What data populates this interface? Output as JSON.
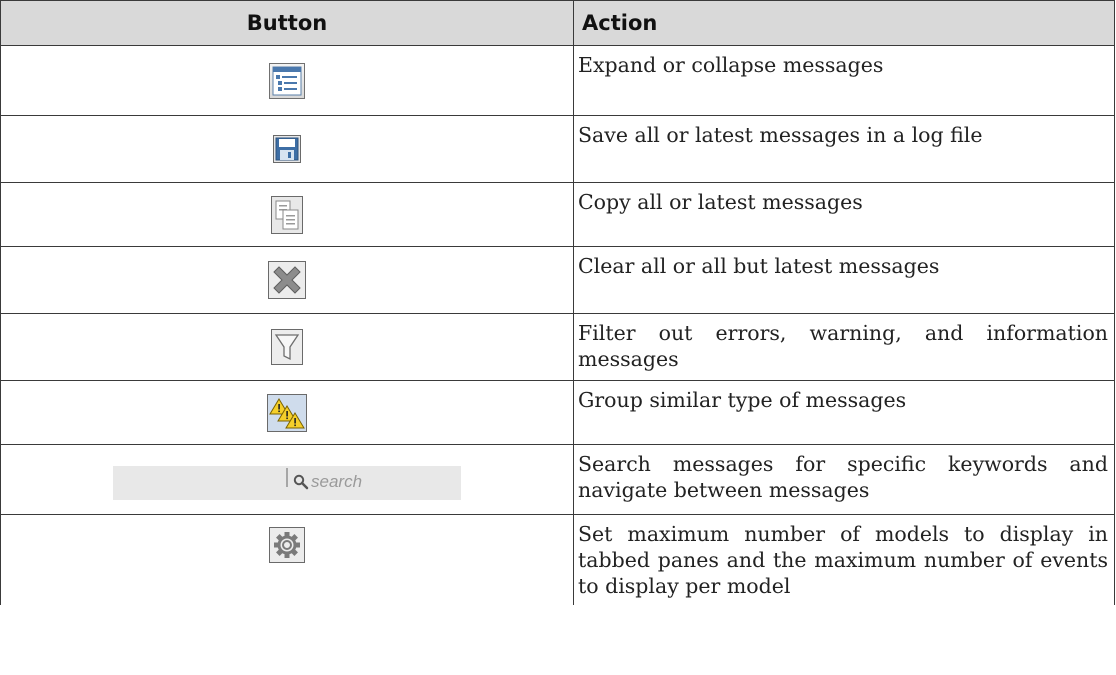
{
  "table": {
    "headers": {
      "button": "Button",
      "action": "Action"
    },
    "rows": [
      {
        "icon": "expand-collapse-icon",
        "action": "Expand or collapse messages"
      },
      {
        "icon": "save-icon",
        "action": "Save all or latest messages in a log file"
      },
      {
        "icon": "copy-icon",
        "action": "Copy all or latest messages"
      },
      {
        "icon": "clear-icon",
        "action": "Clear all or all but latest messages"
      },
      {
        "icon": "filter-icon",
        "action": "Filter out errors, warning, and information messages"
      },
      {
        "icon": "group-warnings-icon",
        "action": "Group similar type of messages"
      },
      {
        "icon": "search-icon",
        "action": "Search messages for specific keywords and navigate between messages"
      },
      {
        "icon": "gear-icon",
        "action": "Set maximum number of models to display in tabbed panes and the maximum number of events to display per model"
      }
    ]
  },
  "search": {
    "placeholder": "search"
  },
  "colors": {
    "header_bg": "#d9d9d9",
    "border": "#3a3a3a",
    "icon_blue": "#3d6ea5",
    "warning_yellow": "#f5cf2a"
  }
}
